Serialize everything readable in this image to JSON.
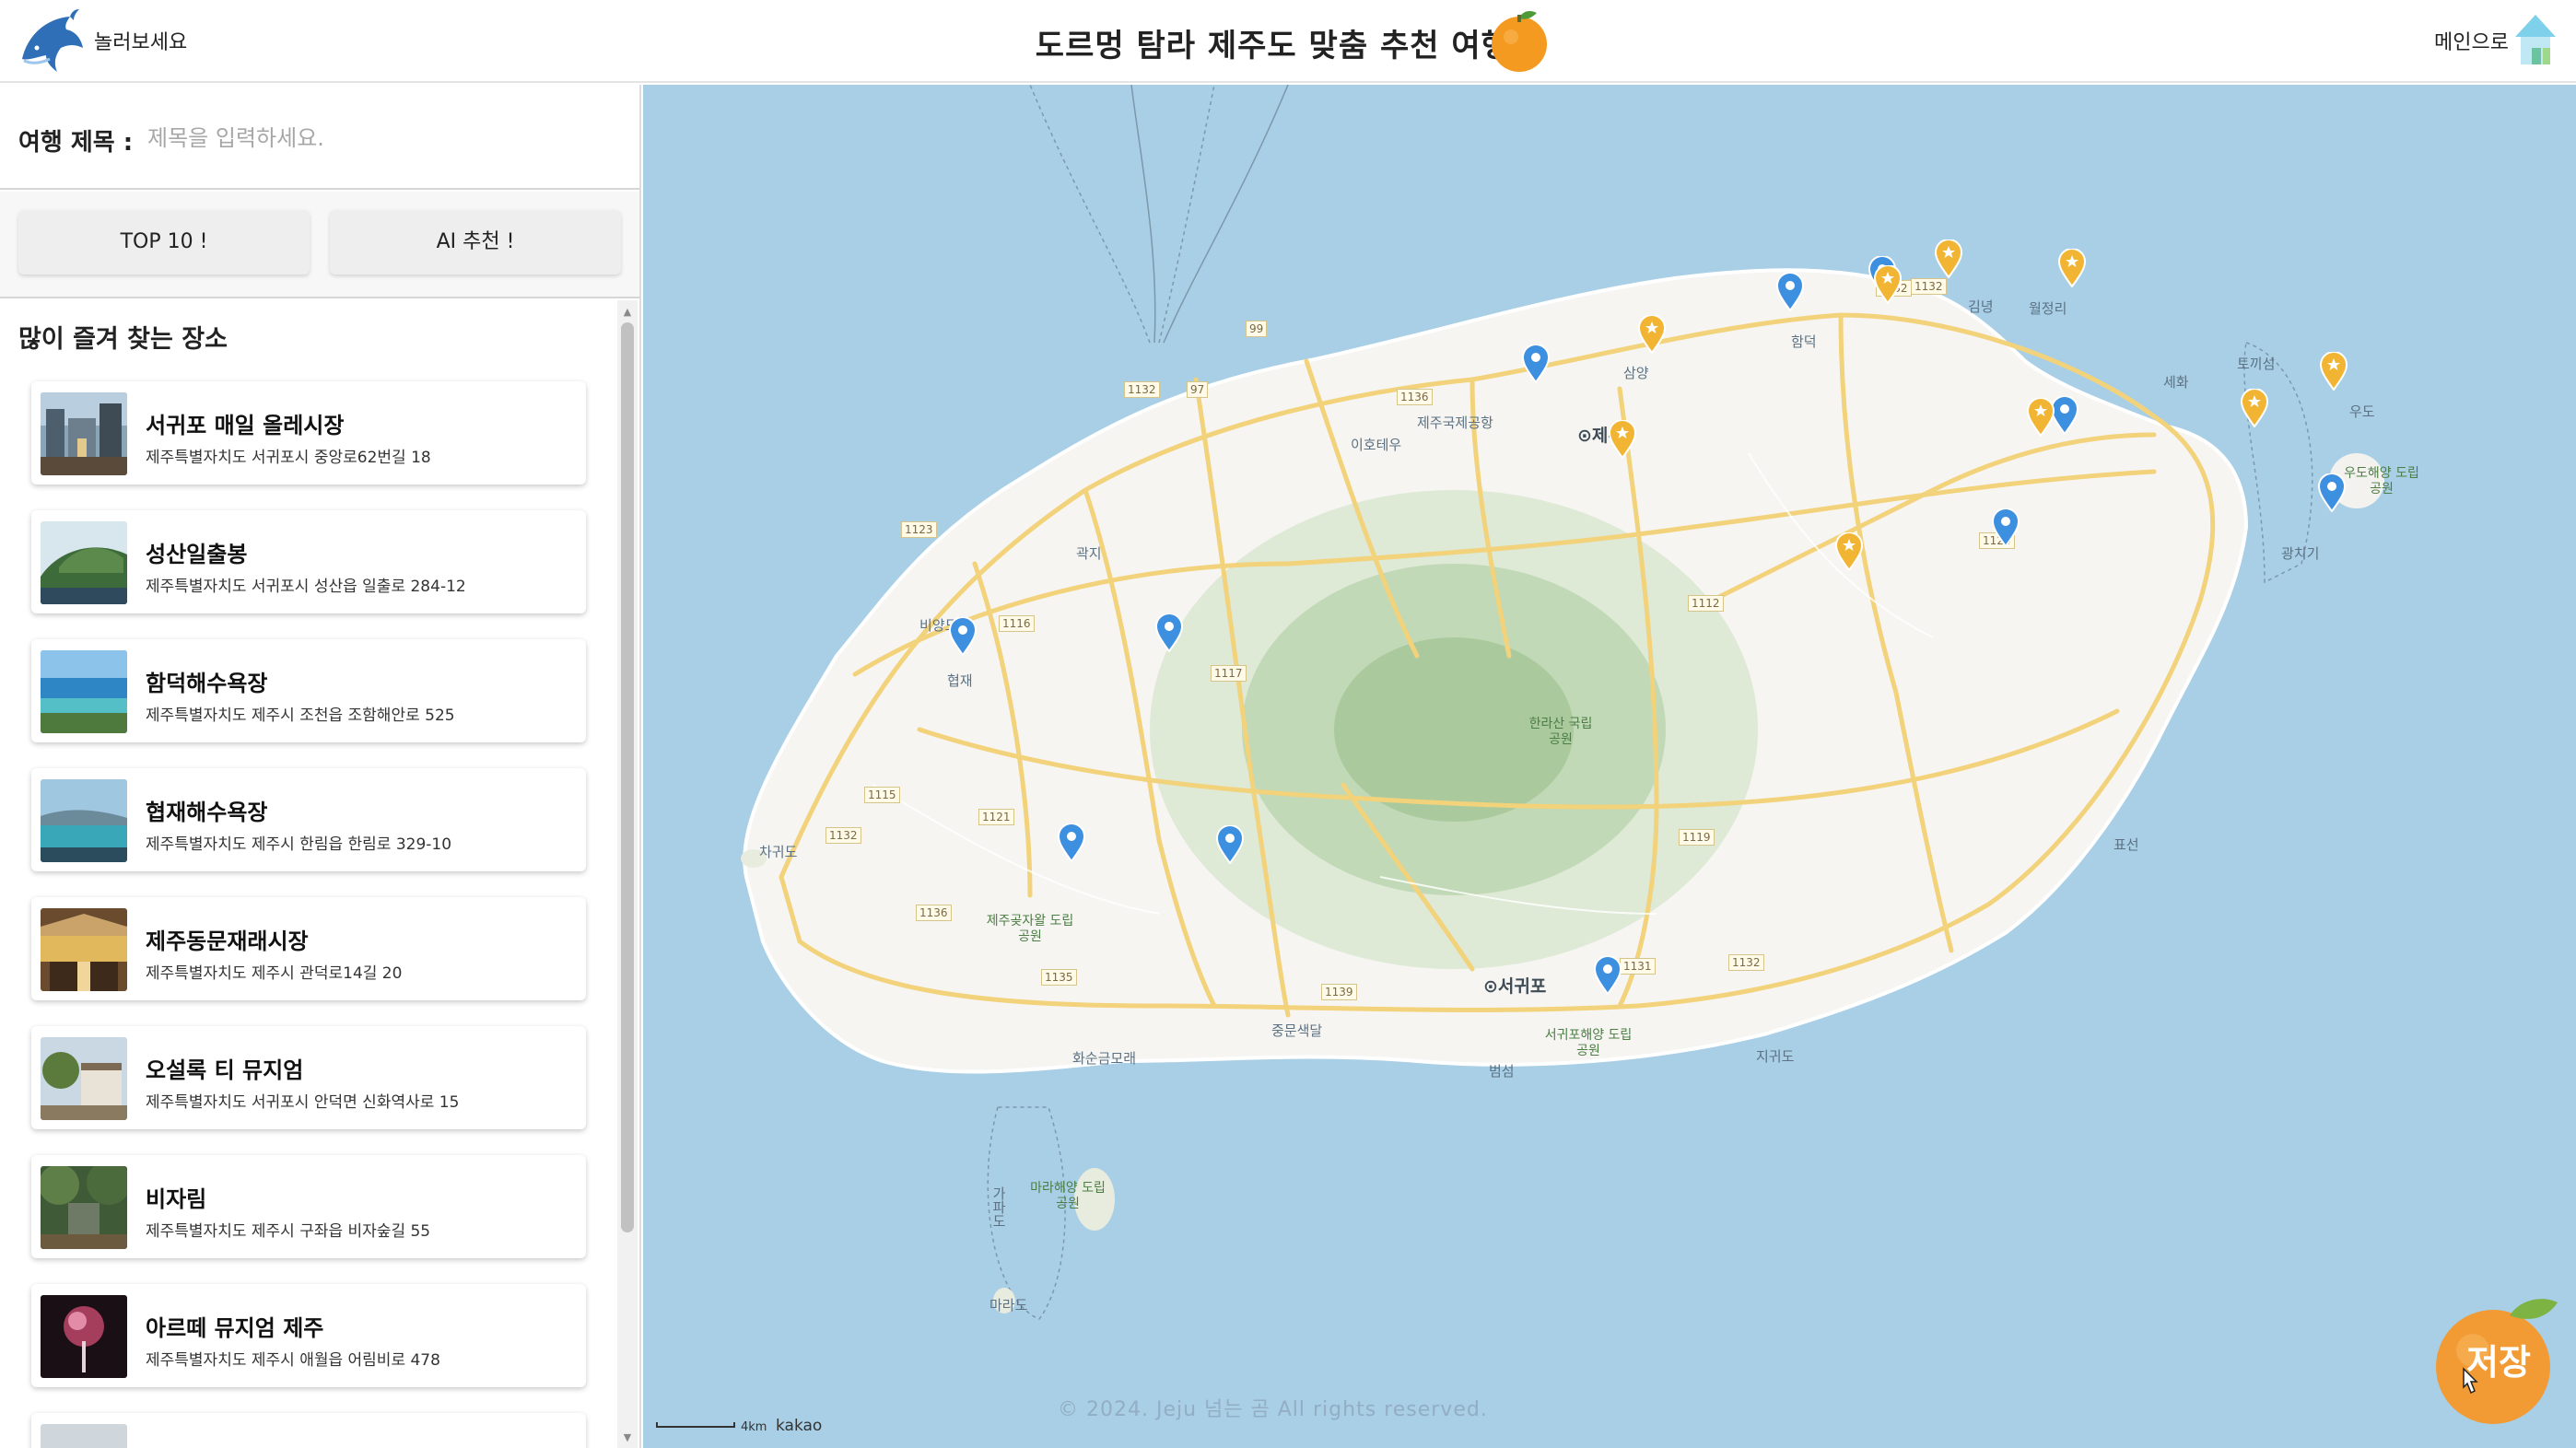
{
  "header": {
    "brand": "놀러보세요",
    "title": "도르멍 탐라 제주도 맞춤 추천 여행지",
    "to_main": "메인으로",
    "logo_icon": "dolphin-icon",
    "title_icon": "tangerine-icon",
    "main_icon": "house-icon"
  },
  "trip": {
    "label": "여행 제목 :",
    "value": "",
    "placeholder": "제목을 입력하세요."
  },
  "tabs": {
    "top10": "TOP 10 !",
    "ai": "AI 추천 !"
  },
  "list": {
    "heading": "많이 즐겨 찾는 장소",
    "items": [
      {
        "name": "서귀포 매일 올레시장",
        "address": "제주특별자치도 서귀포시 중앙로62번길 18"
      },
      {
        "name": "성산일출봉",
        "address": "제주특별자치도 서귀포시 성산읍 일출로 284-12"
      },
      {
        "name": "함덕해수욕장",
        "address": "제주특별자치도 제주시 조천읍 조함해안로 525"
      },
      {
        "name": "협재해수욕장",
        "address": "제주특별자치도 제주시 한림읍 한림로 329-10"
      },
      {
        "name": "제주동문재래시장",
        "address": "제주특별자치도 제주시 관덕로14길 20"
      },
      {
        "name": "오설록 티 뮤지엄",
        "address": "제주특별자치도 서귀포시 안덕면 신화역사로 15"
      },
      {
        "name": "비자림",
        "address": "제주특별자치도 제주시 구좌읍 비자숲길 55"
      },
      {
        "name": "아르떼 뮤지엄 제주",
        "address": "제주특별자치도 제주시 애월읍 어림비로 478"
      }
    ]
  },
  "map": {
    "labels": {
      "jeju_city": "⊙제주",
      "seogwipo": "⊙서귀포",
      "airport": "제주국제공항",
      "iho": "이호테우",
      "gwakji": "곽지",
      "biyang": "비양도",
      "hyeopjae": "협재",
      "chagwido": "차귀도",
      "hamdeok": "함덕",
      "gimnyeong": "김녕",
      "woljeongri": "월정리",
      "sehwa": "세화",
      "tokkiseom": "토끼섬",
      "udo": "우도",
      "gwangchigi": "광치기",
      "pyoseon": "표선",
      "jigwido": "지귀도",
      "beomseom": "범섬",
      "hwasun": "화순금모래",
      "jungmun": "중문색달",
      "marado": "마라도",
      "gapado": "가파도",
      "samyang": "삼양",
      "halla_park": "한라산 국립공원",
      "jeju_gotjawal": "제주곶자왈 도립공원",
      "seogwipo_park": "서귀포해양 도립공원",
      "marine_park": "마라해양 도립공원",
      "udo_park": "우도해양 도립공원"
    },
    "roads": [
      "1132",
      "97",
      "99",
      "1136",
      "1132",
      "1123",
      "1116",
      "1117",
      "1112",
      "1124",
      "1115",
      "1132",
      "1121",
      "1136",
      "1135",
      "1139",
      "1131",
      "1132",
      "1119",
      "1132"
    ],
    "scale_text": "4km",
    "attribution": "kakao",
    "copyright": "© 2024. Jeju 넘는 곰 All rights reserved.",
    "markers": {
      "blue": 11,
      "yellow": 9
    },
    "blue_color": "#3d8fe0",
    "yellow_color": "#f2b533"
  },
  "save": {
    "label": "저장",
    "color": "#f29a33"
  }
}
